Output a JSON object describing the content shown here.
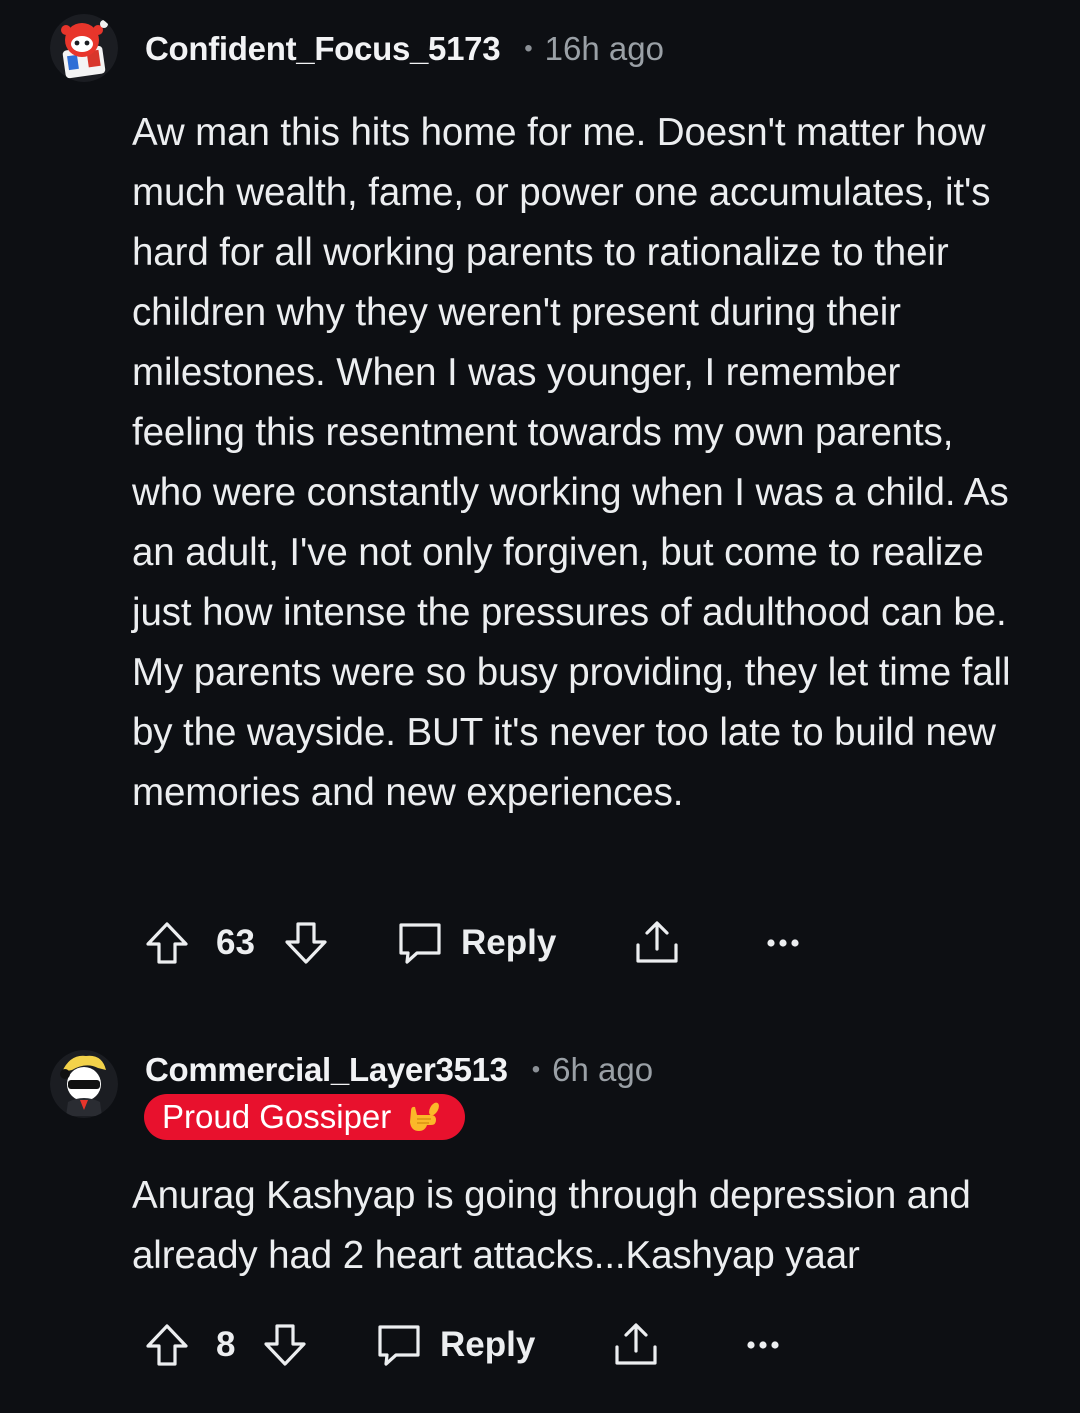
{
  "comments": [
    {
      "username": "Confident_Focus_5173",
      "separator": "•",
      "time": "16h ago",
      "avatar_icon": "snoo-avatar-red-icon",
      "body": "Aw man this hits home for me. Doesn't matter how much wealth, fame, or power one accumulates, it's hard for all working parents to rationalize to their children why they weren't present during their milestones. When I was younger, I remember feeling this resentment towards my own parents, who were constantly working when I was a child. As an adult, I've not only forgiven, but come to realize just how intense the pressures of adulthood can be. My parents were so busy providing, they let time fall by the wayside. BUT it's never too late to build new memories and new experiences.",
      "votes": "63",
      "reply_label": "Reply"
    },
    {
      "username": "Commercial_Layer3513",
      "separator": "•",
      "time": "6h ago",
      "avatar_icon": "panda-avatar-icon",
      "flair": "Proud Gossiper",
      "flair_color": "#e8112d",
      "body": "Anurag Kashyap is going through depression and already had 2 heart attacks...Kashyap yaar",
      "votes": "8",
      "reply_label": "Reply"
    }
  ],
  "colors": {
    "background": "#0d0f13",
    "text": "#eceef0",
    "muted": "#9aa0a6"
  }
}
